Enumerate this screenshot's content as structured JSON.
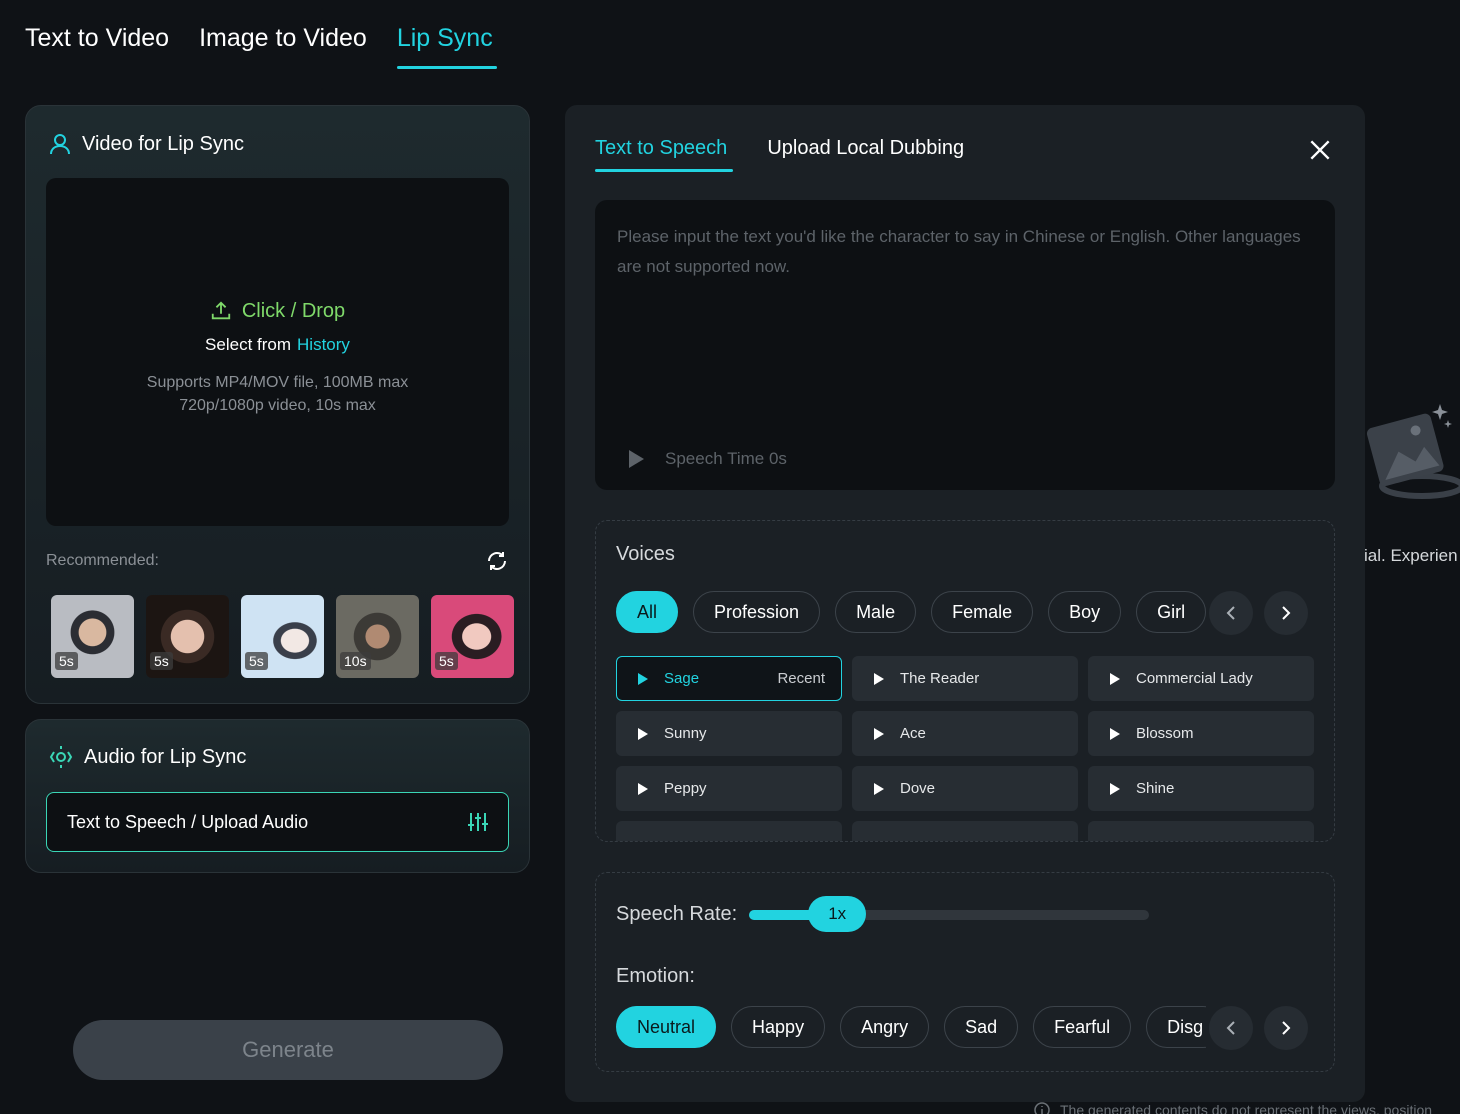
{
  "top_tabs": [
    {
      "label": "Text to Video",
      "active": false
    },
    {
      "label": "Image to Video",
      "active": false
    },
    {
      "label": "Lip Sync",
      "active": true
    }
  ],
  "video_card": {
    "title": "Video for Lip Sync",
    "upload_label": "Click / Drop",
    "select_prefix": "Select from",
    "history_link": "History",
    "hint_line1": "Supports MP4/MOV file, 100MB max",
    "hint_line2": "720p/1080p video, 10s max",
    "recommended_label": "Recommended:",
    "thumbnails": [
      {
        "duration": "5s"
      },
      {
        "duration": "5s"
      },
      {
        "duration": "5s"
      },
      {
        "duration": "10s"
      },
      {
        "duration": "5s"
      }
    ]
  },
  "audio_card": {
    "title": "Audio for Lip Sync",
    "button_label": "Text to Speech / Upload Audio"
  },
  "generate_label": "Generate",
  "panel": {
    "tabs": [
      {
        "label": "Text to Speech",
        "active": true
      },
      {
        "label": "Upload Local Dubbing",
        "active": false
      }
    ],
    "text_placeholder": "Please input the text you'd like the character to say in Chinese or English. Other languages are not supported now.",
    "speech_time": "Speech Time 0s",
    "voices_title": "Voices",
    "voice_filters": [
      {
        "label": "All",
        "active": true
      },
      {
        "label": "Profession",
        "active": false
      },
      {
        "label": "Male",
        "active": false
      },
      {
        "label": "Female",
        "active": false
      },
      {
        "label": "Boy",
        "active": false
      },
      {
        "label": "Girl",
        "active": false
      }
    ],
    "voices": [
      {
        "name": "Sage",
        "tag": "Recent",
        "selected": true
      },
      {
        "name": "The Reader",
        "tag": "",
        "selected": false
      },
      {
        "name": "Commercial Lady",
        "tag": "",
        "selected": false
      },
      {
        "name": "Sunny",
        "tag": "",
        "selected": false
      },
      {
        "name": "Ace",
        "tag": "",
        "selected": false
      },
      {
        "name": "Blossom",
        "tag": "",
        "selected": false
      },
      {
        "name": "Peppy",
        "tag": "",
        "selected": false
      },
      {
        "name": "Dove",
        "tag": "",
        "selected": false
      },
      {
        "name": "Shine",
        "tag": "",
        "selected": false
      }
    ],
    "speech_rate_label": "Speech Rate:",
    "speech_rate_value": "1x",
    "speech_rate_fraction": 0.22,
    "emotion_label": "Emotion:",
    "emotions": [
      {
        "label": "Neutral",
        "active": true
      },
      {
        "label": "Happy",
        "active": false
      },
      {
        "label": "Angry",
        "active": false
      },
      {
        "label": "Sad",
        "active": false
      },
      {
        "label": "Fearful",
        "active": false
      },
      {
        "label": "Disg",
        "active": false
      }
    ]
  },
  "background_text": "ial. Experien",
  "footer_note": "The generated contents do not represent the views, position",
  "colors": {
    "accent": "#22d3e0",
    "upload_green": "#7fd96a",
    "audio_border": "#3ad6b6"
  }
}
